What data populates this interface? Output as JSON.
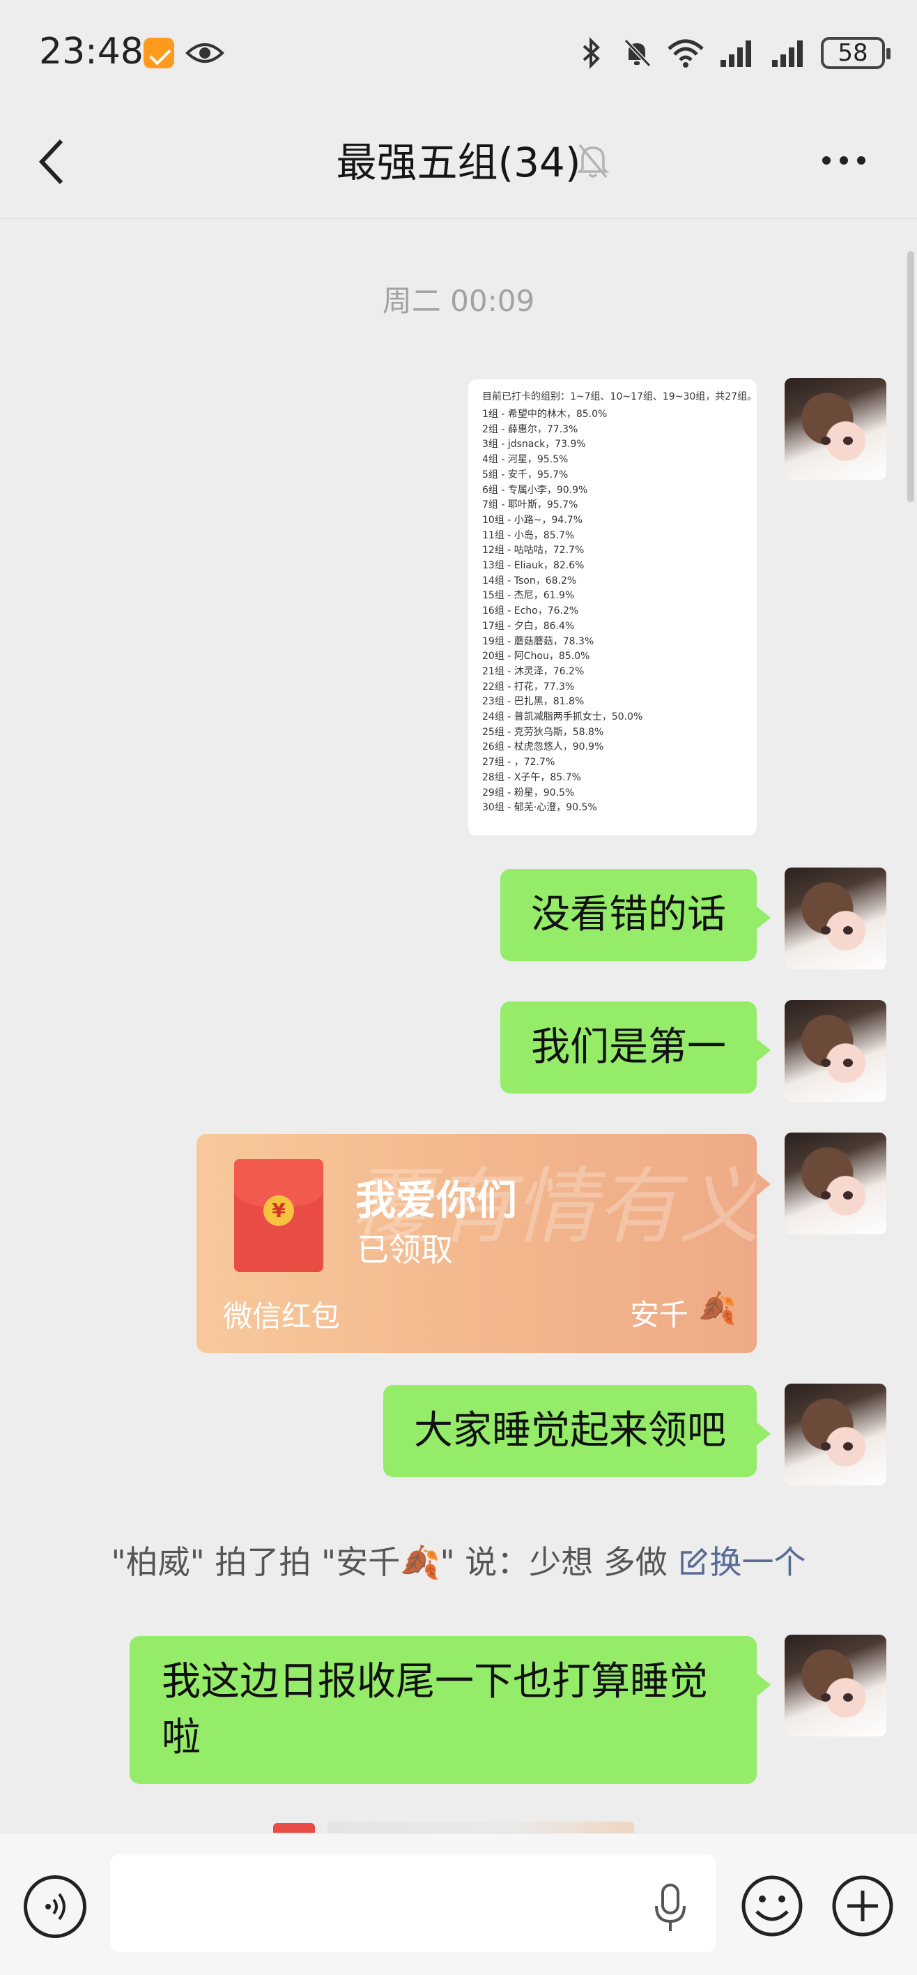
{
  "status_bar": {
    "time": "23:48",
    "battery": "58"
  },
  "nav": {
    "title": "最强五组(34)"
  },
  "chat": {
    "timestamp": "周二 00:09",
    "image_message": {
      "header": "目前已打卡的组别：1~7组、10~17组、19~30组，共27组。",
      "lines": [
        "1组 - 希望中的林木，85.0%",
        "2组 - 薛惠尔，77.3%",
        "3组 - jdsnack，73.9%",
        "4组 - 河星，95.5%",
        "5组 - 安千，95.7%",
        "6组 - 专属小李，90.9%",
        "7组 - 耶叶斯，95.7%",
        "10组 - 小路~，94.7%",
        "11组 - 小岛，85.7%",
        "12组 - 咕咕咕，72.7%",
        "13组 - Eliauk，82.6%",
        "14组 - Tson，68.2%",
        "15组 - 杰尼，61.9%",
        "16组 - Echo，76.2%",
        "17组 - 夕白，86.4%",
        "19组 - 蘑菇蘑菇，78.3%",
        "20组 - 阿Chou，85.0%",
        "21组 - 沐灵泽，76.2%",
        "22组 - 打花，77.3%",
        "23组 - 巴扎黑，81.8%",
        "24组 - 普凯减脂两手抓女士，50.0%",
        "25组 - 克劳狄乌斯，58.8%",
        "26组 - 杖虎忽悠人，90.9%",
        "27组 - ，72.7%",
        "28组 - X子午，85.7%",
        "29组 - 粉星，90.5%",
        "30组 - 郁芜·心澄，90.5%"
      ]
    },
    "messages": [
      {
        "text": "没看错的话"
      },
      {
        "text": "我们是第一"
      },
      {
        "text": "大家睡觉起来领吧"
      },
      {
        "text": "我这边日报收尾一下也打算睡觉啦"
      }
    ],
    "red_packet": {
      "title": "我爱你们",
      "status": "已领取",
      "label": "微信红包",
      "sender": "安千",
      "sender_emoji": "🍂",
      "background_text": "覆有情有义",
      "coin": "¥"
    },
    "pat": {
      "text": "\"柏威\" 拍了拍 \"安千🍂\" 说：少想 多做",
      "change_label": "换一个"
    }
  },
  "input": {
    "value": ""
  },
  "colors": {
    "bubble": "#95ec69",
    "background": "#ededed",
    "link": "#576b95"
  },
  "icons": [
    "eye-icon",
    "bluetooth-icon",
    "mute-bell-icon",
    "wifi-icon",
    "signal-icon",
    "back-icon",
    "more-icon",
    "voice-icon",
    "mic-icon",
    "emoji-icon",
    "plus-icon"
  ]
}
